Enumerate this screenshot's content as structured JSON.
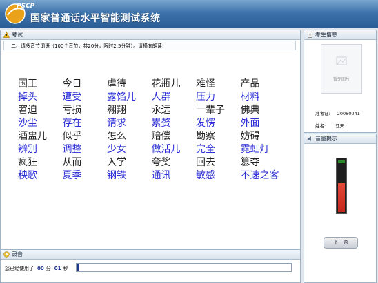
{
  "app": {
    "logo_text": "PSCP",
    "title": "国家普通话水平智能测试系统"
  },
  "exam_panel": {
    "header": "考试",
    "instruction": "二、请多音节词语（100个音节，共20分，限时2.5分钟）。请横向朗读!"
  },
  "word_rows": [
    {
      "color": "black",
      "words": [
        "国王",
        "今日",
        "虐待",
        "花瓶儿",
        "难怪",
        "产品"
      ]
    },
    {
      "color": "blue",
      "words": [
        "掉头",
        "遭受",
        "露馅儿",
        "人群",
        "压力",
        "材料"
      ]
    },
    {
      "color": "black",
      "words": [
        "窘迫",
        "亏损",
        "翱翔",
        "永远",
        "一辈子",
        "佛典"
      ]
    },
    {
      "color": "blue",
      "words": [
        "沙尘",
        "存在",
        "请求",
        "累赘",
        "发愣",
        "外面"
      ]
    },
    {
      "color": "black",
      "words": [
        "酒盅儿",
        "似乎",
        "怎么",
        "赔偿",
        "勘察",
        "妨碍"
      ]
    },
    {
      "color": "blue",
      "words": [
        "辨别",
        "调整",
        "少女",
        "做活儿",
        "完全",
        "霓虹灯"
      ]
    },
    {
      "color": "black",
      "words": [
        "疯狂",
        "从而",
        "入学",
        "夸奖",
        "回去",
        "篡夺"
      ]
    },
    {
      "color": "blue",
      "words": [
        "秧歌",
        "夏季",
        "钢铁",
        "通讯",
        "敏感",
        "不速之客"
      ]
    }
  ],
  "record_panel": {
    "header": "录音",
    "elapsed_label": "您已经使用了",
    "minutes": "00",
    "min_unit": "分",
    "seconds": "01",
    "sec_unit": "秒"
  },
  "candidate_panel": {
    "header": "考生信息",
    "photo_placeholder": "暂无图片",
    "id_label": "准考证:",
    "id_value": "20080041",
    "name_label": "姓名:",
    "name_value": "江天"
  },
  "volume_panel": {
    "header": "音量提示",
    "level_fraction": 0.55
  },
  "next_button": "下一题"
}
